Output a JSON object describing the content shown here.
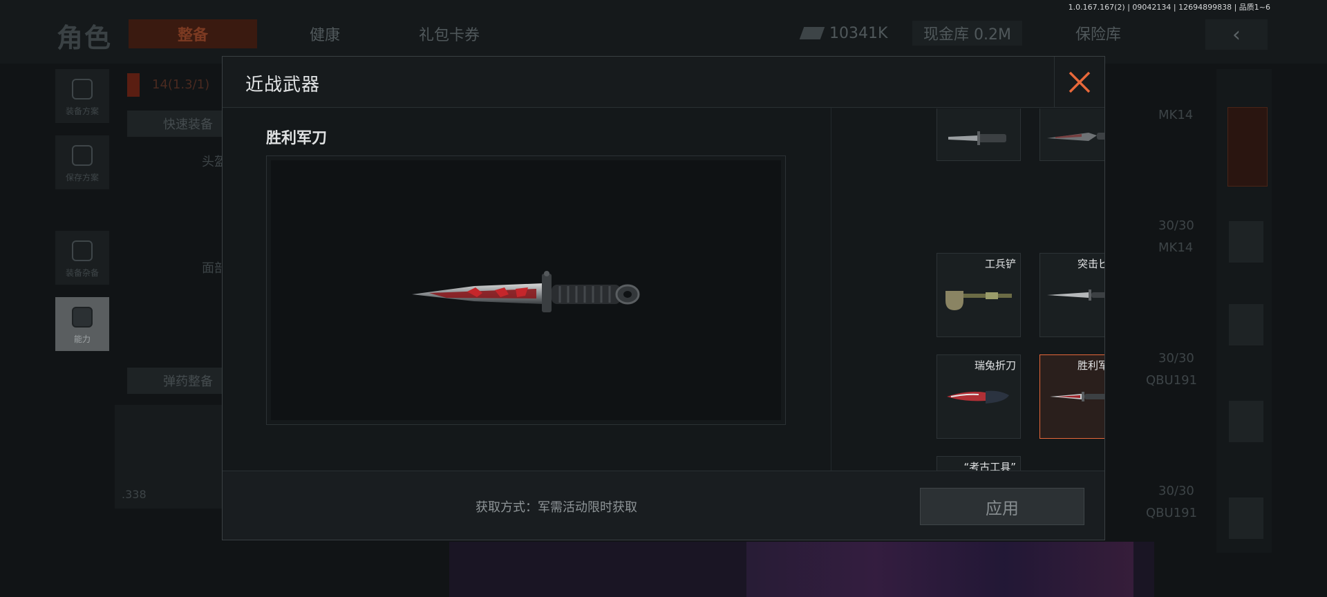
{
  "version_text": "1.0.167.167(2) | 09042134 | 12694899838 | 品质1~6",
  "background": {
    "screen_title": "角色",
    "tabs": [
      "整备",
      "健康",
      "礼包卡券"
    ],
    "currency_value": "10341K",
    "cash_vault": "现金库 0.2M",
    "insurance_vault": "保险库",
    "back_label": "‹",
    "side_menu": [
      "装备方案",
      "保存方案",
      "装备杂备",
      "能力"
    ],
    "quick_equip": "快速装备",
    "ammo_equip": "弹药整备",
    "slot_labels": [
      "头盔",
      "面部"
    ],
    "bottom_value": ".338",
    "right_items": [
      {
        "name": "MK14",
        "ammo": ""
      },
      {
        "name": "MK14",
        "ammo": "30/30"
      },
      {
        "name": "QBU191",
        "ammo": "30/30"
      },
      {
        "name": "QBU191",
        "ammo": "30/30"
      }
    ],
    "red_tag": "14(1.3/1)"
  },
  "modal": {
    "title": "近战武器",
    "close_icon": "close-x-icon",
    "selected_weapon": "胜利军刀",
    "weapons": [
      {
        "name": "",
        "selected": false
      },
      {
        "name": "",
        "selected": false
      },
      {
        "name": "工兵铲",
        "selected": false
      },
      {
        "name": "突击匕首",
        "selected": false
      },
      {
        "name": "瑞兔折刀",
        "selected": false
      },
      {
        "name": "胜利军刀",
        "selected": true
      },
      {
        "name": "“考古工具”\n撬棍",
        "selected": false
      }
    ],
    "acquisition": "获取方式：军需活动限时获取",
    "apply_label": "应用",
    "accent_color": "#e8683a"
  }
}
